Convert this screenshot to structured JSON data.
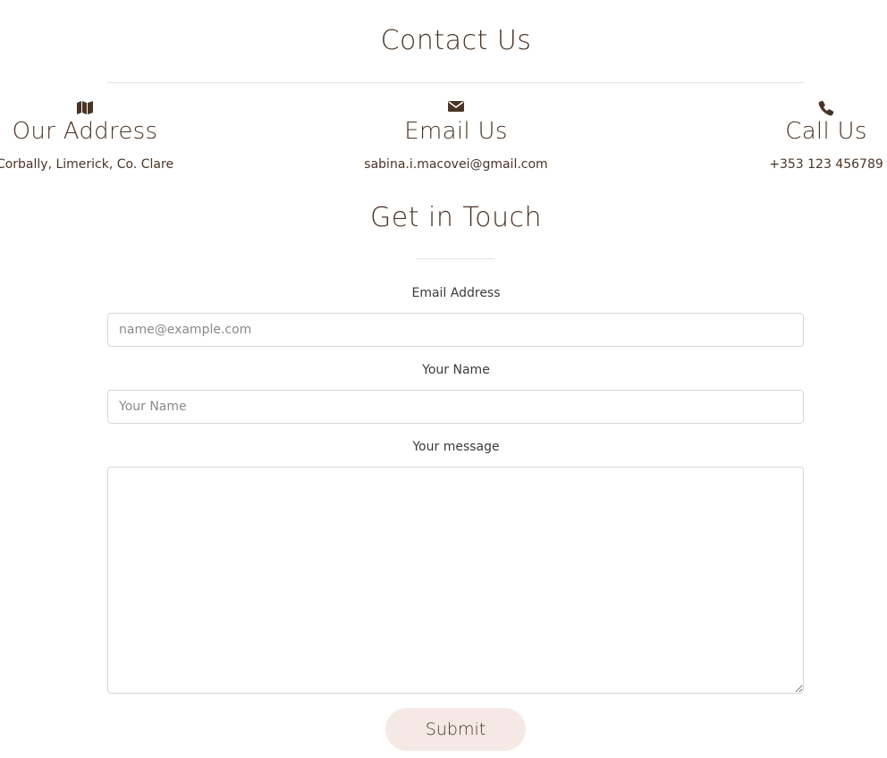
{
  "contact": {
    "title": "Contact Us",
    "columns": [
      {
        "icon": "map-icon",
        "heading": "Our Address",
        "value": "Corbally, Limerick, Co. Clare"
      },
      {
        "icon": "envelope-icon",
        "heading": "Email Us",
        "value": "sabina.i.macovei@gmail.com"
      },
      {
        "icon": "phone-icon",
        "heading": "Call Us",
        "value": "+353 123 456789"
      }
    ]
  },
  "form": {
    "title": "Get in Touch",
    "email_label": "Email Address",
    "email_placeholder": "name@example.com",
    "name_label": "Your Name",
    "name_placeholder": "Your Name",
    "message_label": "Your message",
    "submit_label": "Submit"
  },
  "colors": {
    "text": "#4a3426",
    "button_bg": "#f5e9e5",
    "rule": "#e3e3e3"
  }
}
